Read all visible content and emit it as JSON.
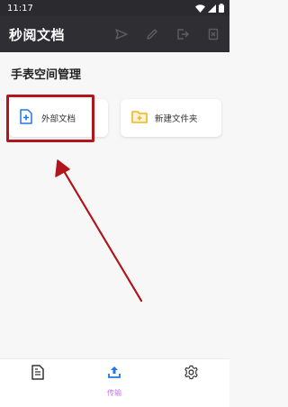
{
  "status_bar": {
    "time": "11:17"
  },
  "app_bar": {
    "title": "秒阅文档",
    "actions": [
      "send-icon",
      "edit-icon",
      "exit-icon",
      "delete-icon"
    ]
  },
  "section": {
    "title": "手表空间管理"
  },
  "cards": {
    "external": {
      "label": "外部文档",
      "icon": "document-add-icon"
    },
    "new_folder": {
      "label": "新建文件夹",
      "icon": "folder-add-icon"
    }
  },
  "bottom_nav": {
    "items": [
      {
        "name": "documents",
        "icon": "document-icon",
        "label": ""
      },
      {
        "name": "transfer",
        "icon": "upload-icon",
        "label": "传输"
      },
      {
        "name": "settings",
        "icon": "gear-icon",
        "label": ""
      }
    ]
  },
  "colors": {
    "app_bar": "#2f2f33",
    "accent_blue": "#1e78e6",
    "folder_yellow": "#f2b51d",
    "highlight_red": "#b0161c",
    "nav_active": "#c077e6"
  }
}
